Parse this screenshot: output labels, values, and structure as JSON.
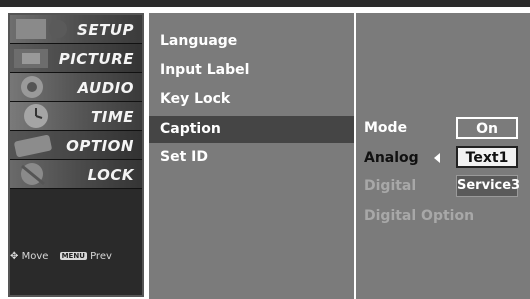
{
  "categories": [
    {
      "label": "SETUP"
    },
    {
      "label": "PICTURE"
    },
    {
      "label": "AUDIO"
    },
    {
      "label": "TIME"
    },
    {
      "label": "OPTION"
    },
    {
      "label": "LOCK"
    }
  ],
  "footer": {
    "move_label": "Move",
    "menu_key": "MENU",
    "prev_label": "Prev"
  },
  "option_menu": {
    "items": [
      {
        "label": "Language"
      },
      {
        "label": "Input Label"
      },
      {
        "label": "Key Lock"
      },
      {
        "label": "Caption",
        "selected": true
      },
      {
        "label": "Set ID"
      }
    ]
  },
  "caption_panel": {
    "mode": {
      "label": "Mode",
      "value": "On"
    },
    "analog": {
      "label": "Analog",
      "value": "Text1"
    },
    "digital": {
      "label": "Digital",
      "value": "Service3"
    },
    "digital_option": {
      "label": "Digital Option"
    }
  },
  "colors": {
    "panel": "#7b7b7b",
    "selected_row": "#454545",
    "disabled_text": "#a8a8a8"
  }
}
